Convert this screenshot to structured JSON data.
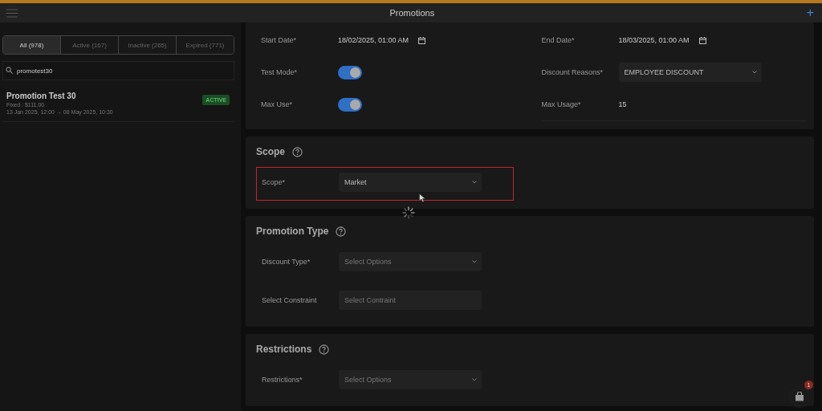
{
  "header": {
    "title": "Promotions",
    "add_label": "+"
  },
  "filter_tabs": [
    {
      "label": "All (978)",
      "selected": true
    },
    {
      "label": "Active (167)",
      "selected": false
    },
    {
      "label": "Inactive (265)",
      "selected": false
    },
    {
      "label": "Expired (771)",
      "selected": false
    }
  ],
  "search": {
    "value": "promotest30"
  },
  "promotions": [
    {
      "name": "Promotion Test 30",
      "discount": "Fixed : $111.00",
      "period": "13 Jan 2025, 12:00 → 08 May 2025, 10:30",
      "status": "ACTIVE"
    }
  ],
  "details": {
    "fields": [
      {
        "kind": "date",
        "label": "Start Date*",
        "value": "18/02/2025, 01:00 AM"
      },
      {
        "kind": "date",
        "label": "End Date*",
        "value": "18/03/2025, 01:00 AM"
      },
      {
        "kind": "toggle",
        "label": "Test Mode*",
        "on": true
      },
      {
        "kind": "select",
        "label": "Discount Reasons*",
        "value": "EMPLOYEE DISCOUNT"
      },
      {
        "kind": "toggle",
        "label": "Max Use*",
        "on": true
      },
      {
        "kind": "text",
        "label": "Max Usage*",
        "value": "15"
      }
    ]
  },
  "sections": [
    {
      "title": "Scope",
      "highlighted": true,
      "loading": true,
      "fields": [
        {
          "kind": "select",
          "label": "Scope*",
          "value": "Market"
        }
      ]
    },
    {
      "title": "Promotion Type",
      "highlighted": false,
      "loading": false,
      "fields": [
        {
          "kind": "select",
          "label": "Discount Type*",
          "placeholder": "Select Options"
        },
        {
          "kind": "input",
          "label": "Select Constraint",
          "placeholder": "Select Contraint"
        }
      ]
    },
    {
      "title": "Restrictions",
      "highlighted": false,
      "loading": false,
      "fields": [
        {
          "kind": "select",
          "label": "Restrictions*",
          "placeholder": "Select Options"
        }
      ]
    }
  ],
  "cart": {
    "badge": "1"
  }
}
